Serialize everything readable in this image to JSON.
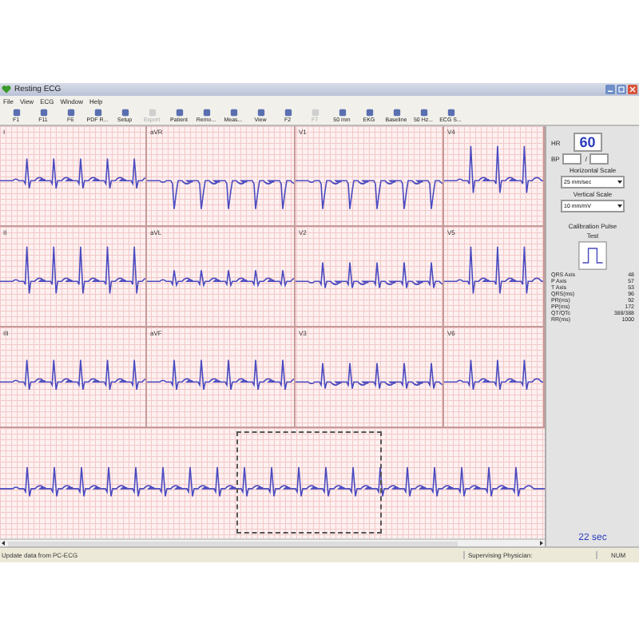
{
  "window": {
    "title": "Resting ECG"
  },
  "menu": [
    "File",
    "View",
    "ECG",
    "Window",
    "Help"
  ],
  "toolbar": [
    {
      "label": "F1",
      "disabled": false
    },
    {
      "label": "F11",
      "disabled": false
    },
    {
      "label": "F6",
      "disabled": false
    },
    {
      "label": "PDF R...",
      "disabled": false
    },
    {
      "label": "Setup",
      "disabled": false
    },
    {
      "label": "Export",
      "disabled": true
    },
    {
      "label": "Patient",
      "disabled": false
    },
    {
      "label": "Remo...",
      "disabled": false
    },
    {
      "label": "Meas...",
      "disabled": false
    },
    {
      "label": "View",
      "disabled": false
    },
    {
      "label": "F2",
      "disabled": false
    },
    {
      "label": "F7",
      "disabled": true
    },
    {
      "label": "50 mm",
      "disabled": false
    },
    {
      "label": "EKG",
      "disabled": false
    },
    {
      "label": "Baseline",
      "disabled": false
    },
    {
      "label": "50 Hz...",
      "disabled": false
    },
    {
      "label": "ECG S...",
      "disabled": false
    }
  ],
  "leads": [
    {
      "label": "I",
      "kind": "upright"
    },
    {
      "label": "aVR",
      "kind": "inverted"
    },
    {
      "label": "V1",
      "kind": "inverted"
    },
    {
      "label": "V4",
      "kind": "tall"
    },
    {
      "label": "II",
      "kind": "tall"
    },
    {
      "label": "aVL",
      "kind": "small"
    },
    {
      "label": "V2",
      "kind": "biphasic"
    },
    {
      "label": "V5",
      "kind": "tall"
    },
    {
      "label": "III",
      "kind": "upright"
    },
    {
      "label": "aVF",
      "kind": "upright"
    },
    {
      "label": "V3",
      "kind": "biphasic"
    },
    {
      "label": "V6",
      "kind": "upright"
    }
  ],
  "rhythm": {
    "kind": "upright"
  },
  "panel": {
    "hr_label": "HR",
    "hr": "60",
    "bp_label": "BP",
    "bp_sep": "/",
    "horizontal_scale_label": "Horizontal Scale",
    "horizontal_scale": "25 mm/sec",
    "vertical_scale_label": "Vertical Scale",
    "vertical_scale": "10 mm/mV",
    "calibration_label": "Calibration Pulse",
    "calibration_test": "Test",
    "measurements": [
      {
        "name": "QRS Axis",
        "value": "48"
      },
      {
        "name": "P Axis",
        "value": "57"
      },
      {
        "name": "T Axis",
        "value": "53"
      },
      {
        "name": "QRS(ms)",
        "value": "96"
      },
      {
        "name": "PR(ms)",
        "value": "92"
      },
      {
        "name": "PP(ms)",
        "value": "172"
      },
      {
        "name": "QT/QTc",
        "value": "388/388"
      },
      {
        "name": "RR(ms)",
        "value": "1000"
      }
    ],
    "duration": "22 sec"
  },
  "status_bar": {
    "message": "Update data from PC-ECG",
    "physician": "Supervising Physician:",
    "num": "NUM"
  }
}
